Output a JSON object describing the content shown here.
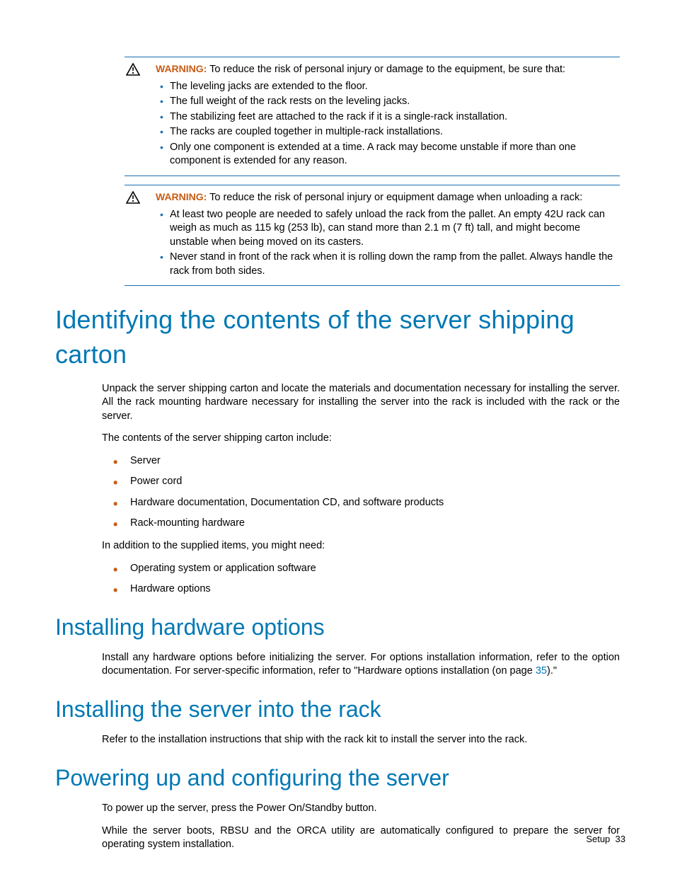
{
  "warning1": {
    "label": "WARNING:",
    "intro": "To reduce the risk of personal injury or damage to the equipment, be sure that:",
    "items": [
      "The leveling jacks are extended to the floor.",
      "The full weight of the rack rests on the leveling jacks.",
      "The stabilizing feet are attached to the rack if it is a single-rack installation.",
      "The racks are coupled together in multiple-rack installations.",
      "Only one component is extended at a time. A rack may become unstable if more than one component is extended for any reason."
    ]
  },
  "warning2": {
    "label": "WARNING:",
    "intro": "To reduce the risk of personal injury or equipment damage when unloading a rack:",
    "items": [
      "At least two people are needed to safely unload the rack from the pallet. An empty 42U rack can weigh as much as 115 kg (253 lb), can stand more than 2.1 m (7 ft) tall, and might become unstable when being moved on its casters.",
      "Never stand in front of the rack when it is rolling down the ramp from the pallet. Always handle the rack from both sides."
    ]
  },
  "h_identifying": "Identifying the contents of the server shipping carton",
  "para_unpack": "Unpack the server shipping carton and locate the materials and documentation necessary for installing the server. All the rack mounting hardware necessary for installing the server into the rack is included with the rack or the server.",
  "para_contents": "The contents of the server shipping carton include:",
  "list_contents": [
    "Server",
    "Power cord",
    "Hardware documentation, Documentation CD, and software products",
    "Rack-mounting hardware"
  ],
  "para_addition": "In addition to the supplied items, you might need:",
  "list_addition": [
    "Operating system or application software",
    "Hardware options"
  ],
  "h_install_hw": "Installing hardware options",
  "para_install_hw_a": "Install any hardware options before initializing the server. For options installation information, refer to the option documentation. For server-specific information, refer to \"Hardware options installation (on page ",
  "link_35": "35",
  "para_install_hw_b": ").\"",
  "h_install_rack": "Installing the server into the rack",
  "para_install_rack": "Refer to the installation instructions that ship with the rack kit to install the server into the rack.",
  "h_power": "Powering up and configuring the server",
  "para_power1": "To power up the server, press the Power On/Standby button.",
  "para_power2": "While the server boots, RBSU and the ORCA utility are automatically configured to prepare the server for operating system installation.",
  "footer_section": "Setup",
  "footer_page": "33"
}
